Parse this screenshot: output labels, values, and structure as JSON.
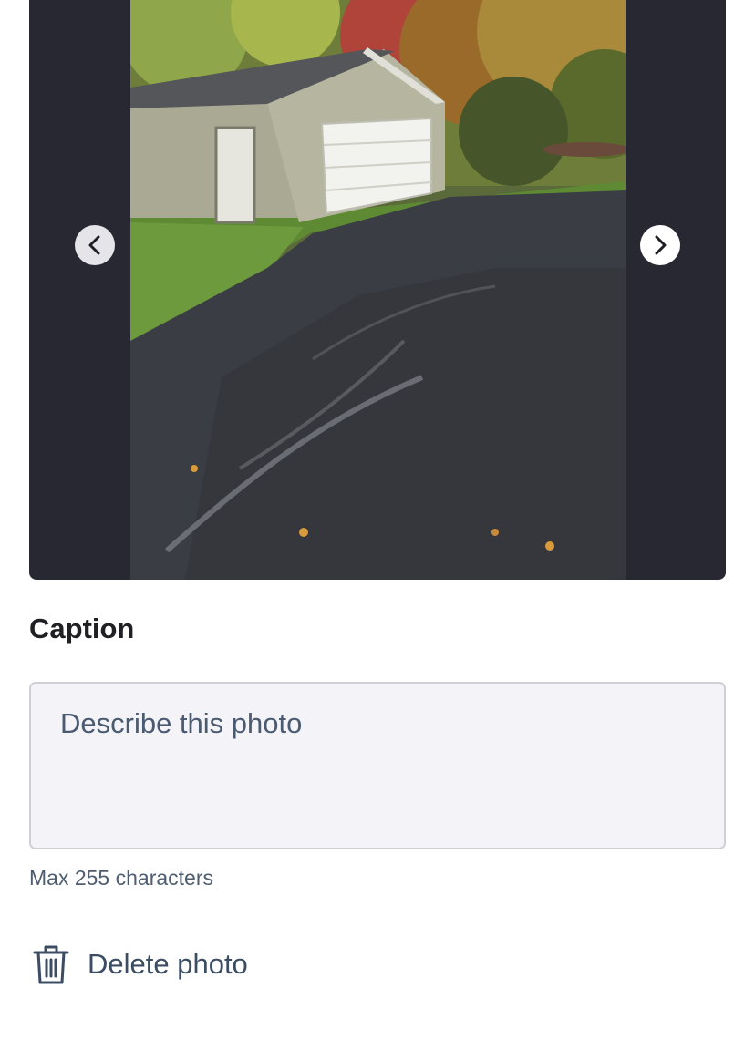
{
  "viewer": {
    "prev_icon": "chevron-left-icon",
    "next_icon": "chevron-right-icon"
  },
  "caption": {
    "heading": "Caption",
    "placeholder": "Describe this photo",
    "value": "",
    "hint": "Max 255 characters"
  },
  "actions": {
    "delete_label": "Delete photo",
    "delete_icon": "trash-icon"
  }
}
